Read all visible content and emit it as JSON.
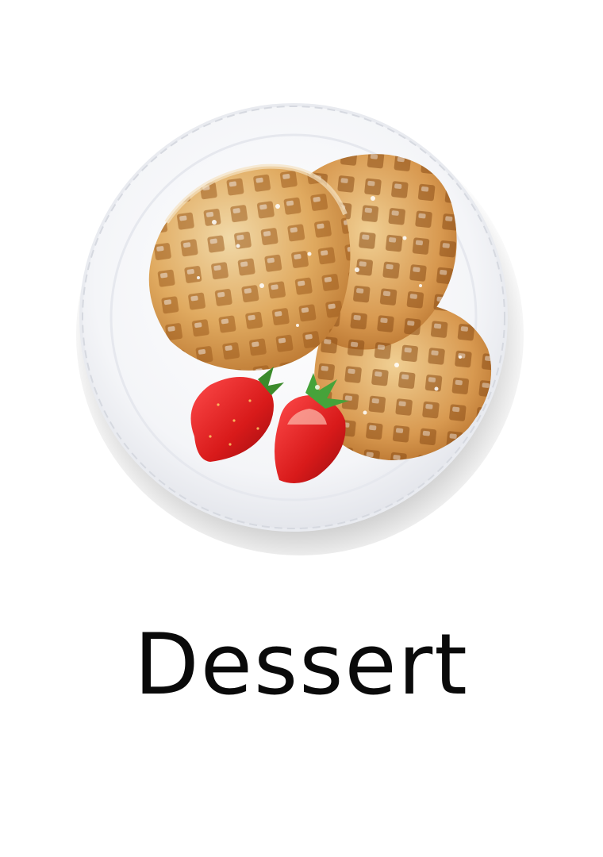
{
  "category": {
    "name": "Dessert"
  }
}
